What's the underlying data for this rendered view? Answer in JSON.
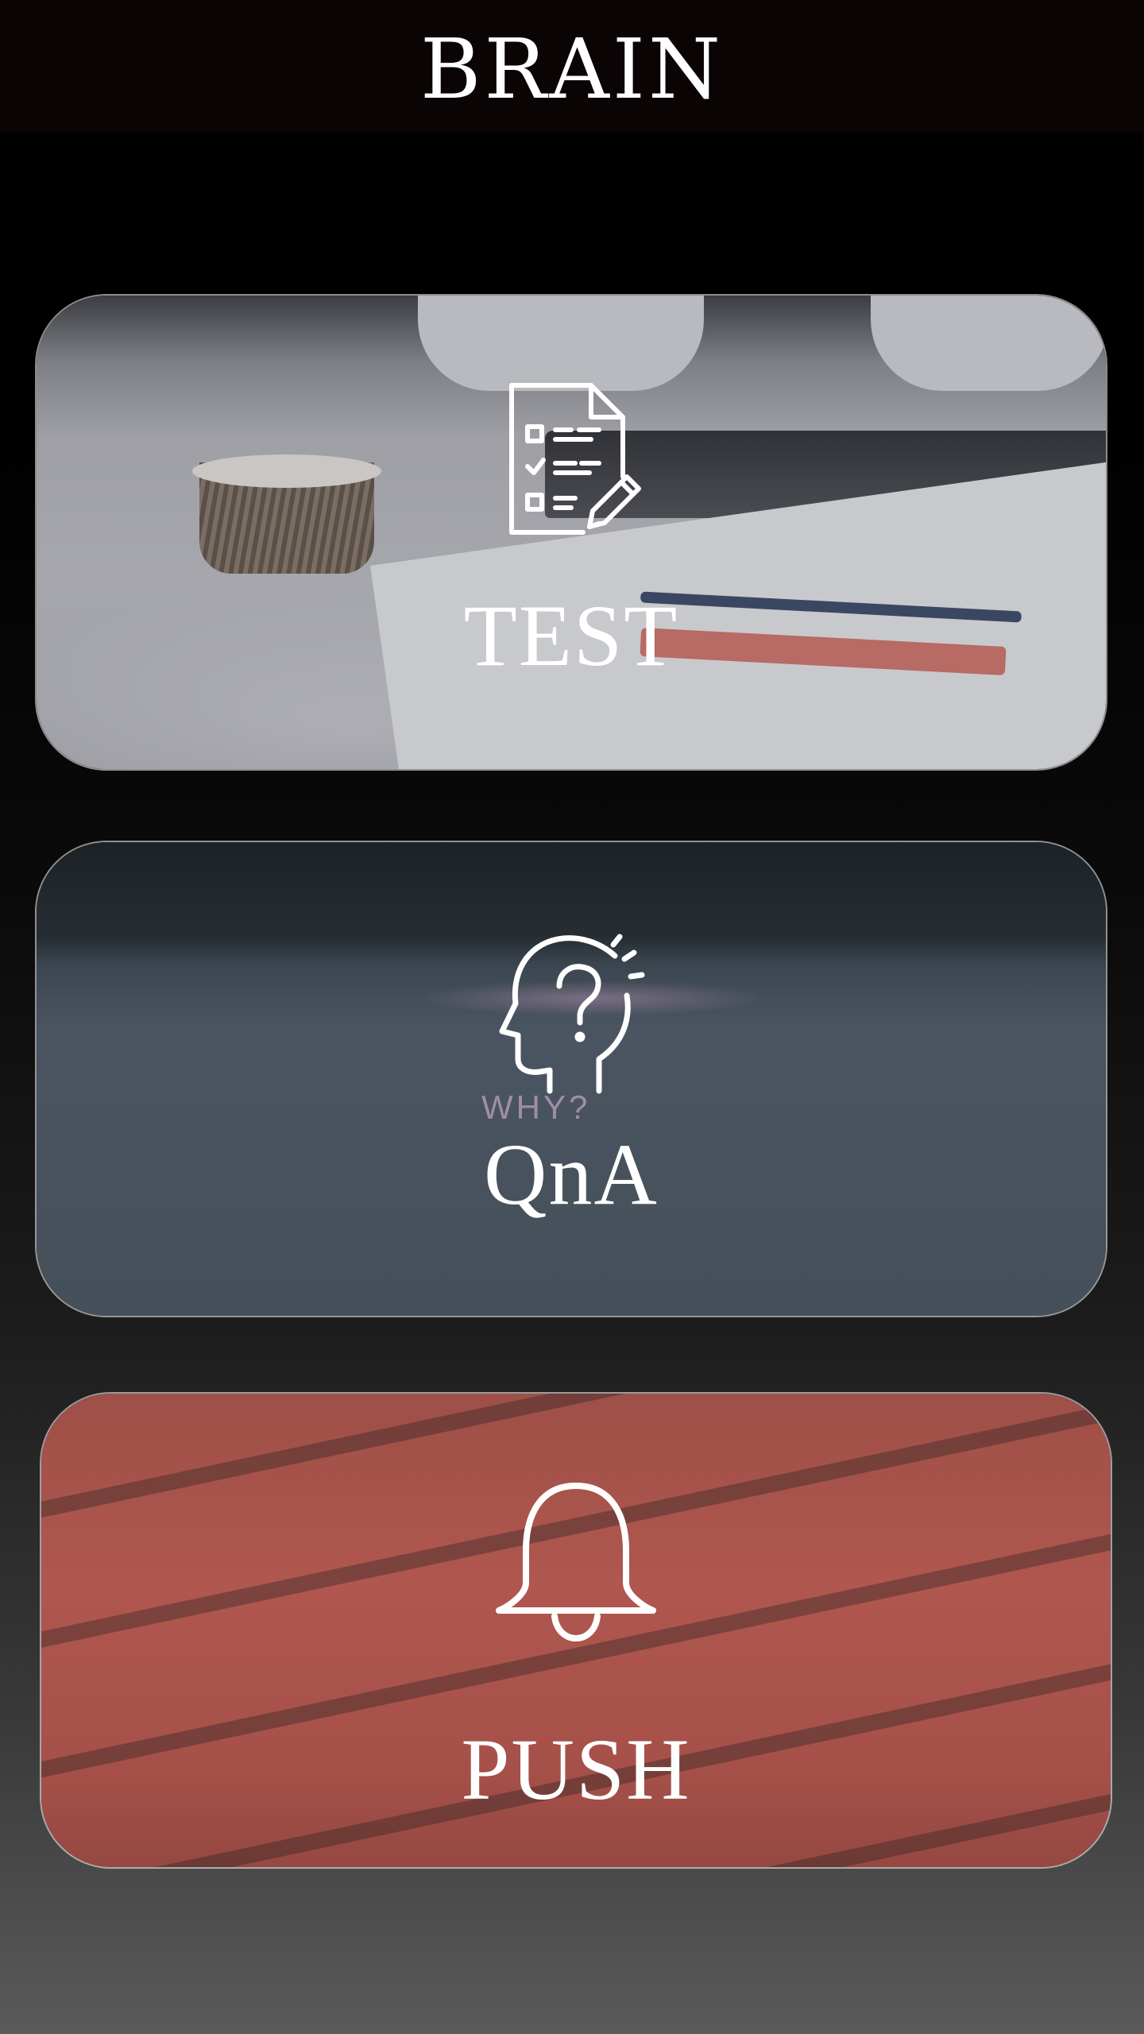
{
  "header": {
    "title": "BRAIN"
  },
  "cards": [
    {
      "id": "test",
      "label": "TEST",
      "icon": "test-checklist-icon"
    },
    {
      "id": "qna",
      "label": "QnA",
      "icon": "head-question-icon",
      "background_text": "WHY?"
    },
    {
      "id": "push",
      "label": "PUSH",
      "icon": "bell-icon"
    }
  ],
  "colors": {
    "header_bg": "#0a0404",
    "text": "#ffffff"
  }
}
